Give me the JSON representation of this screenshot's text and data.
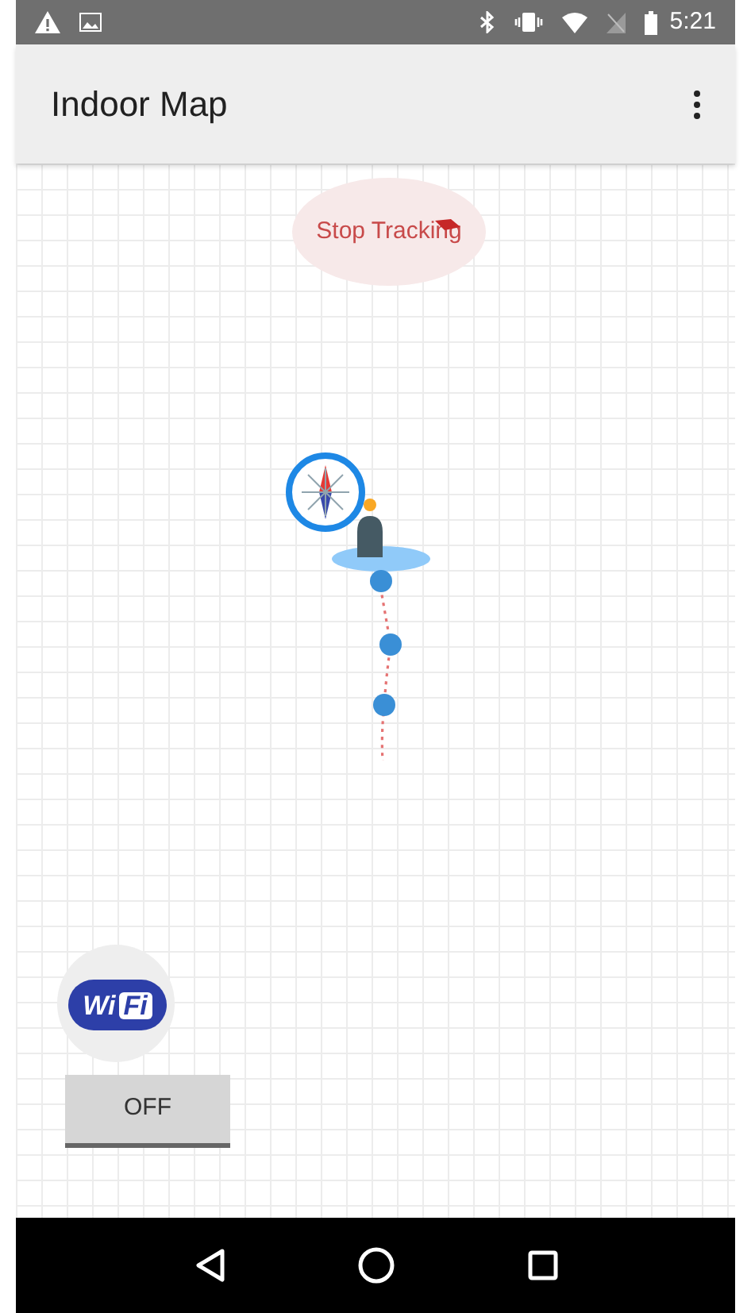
{
  "status_bar": {
    "time": "5:21"
  },
  "app_bar": {
    "title": "Indoor Map"
  },
  "map": {
    "stop_tracking": {
      "label": "Stop Tracking"
    },
    "wifi": {
      "logo_left": "Wi",
      "logo_right": "Fi",
      "toggle": {
        "label": "OFF",
        "on": false
      }
    }
  }
}
